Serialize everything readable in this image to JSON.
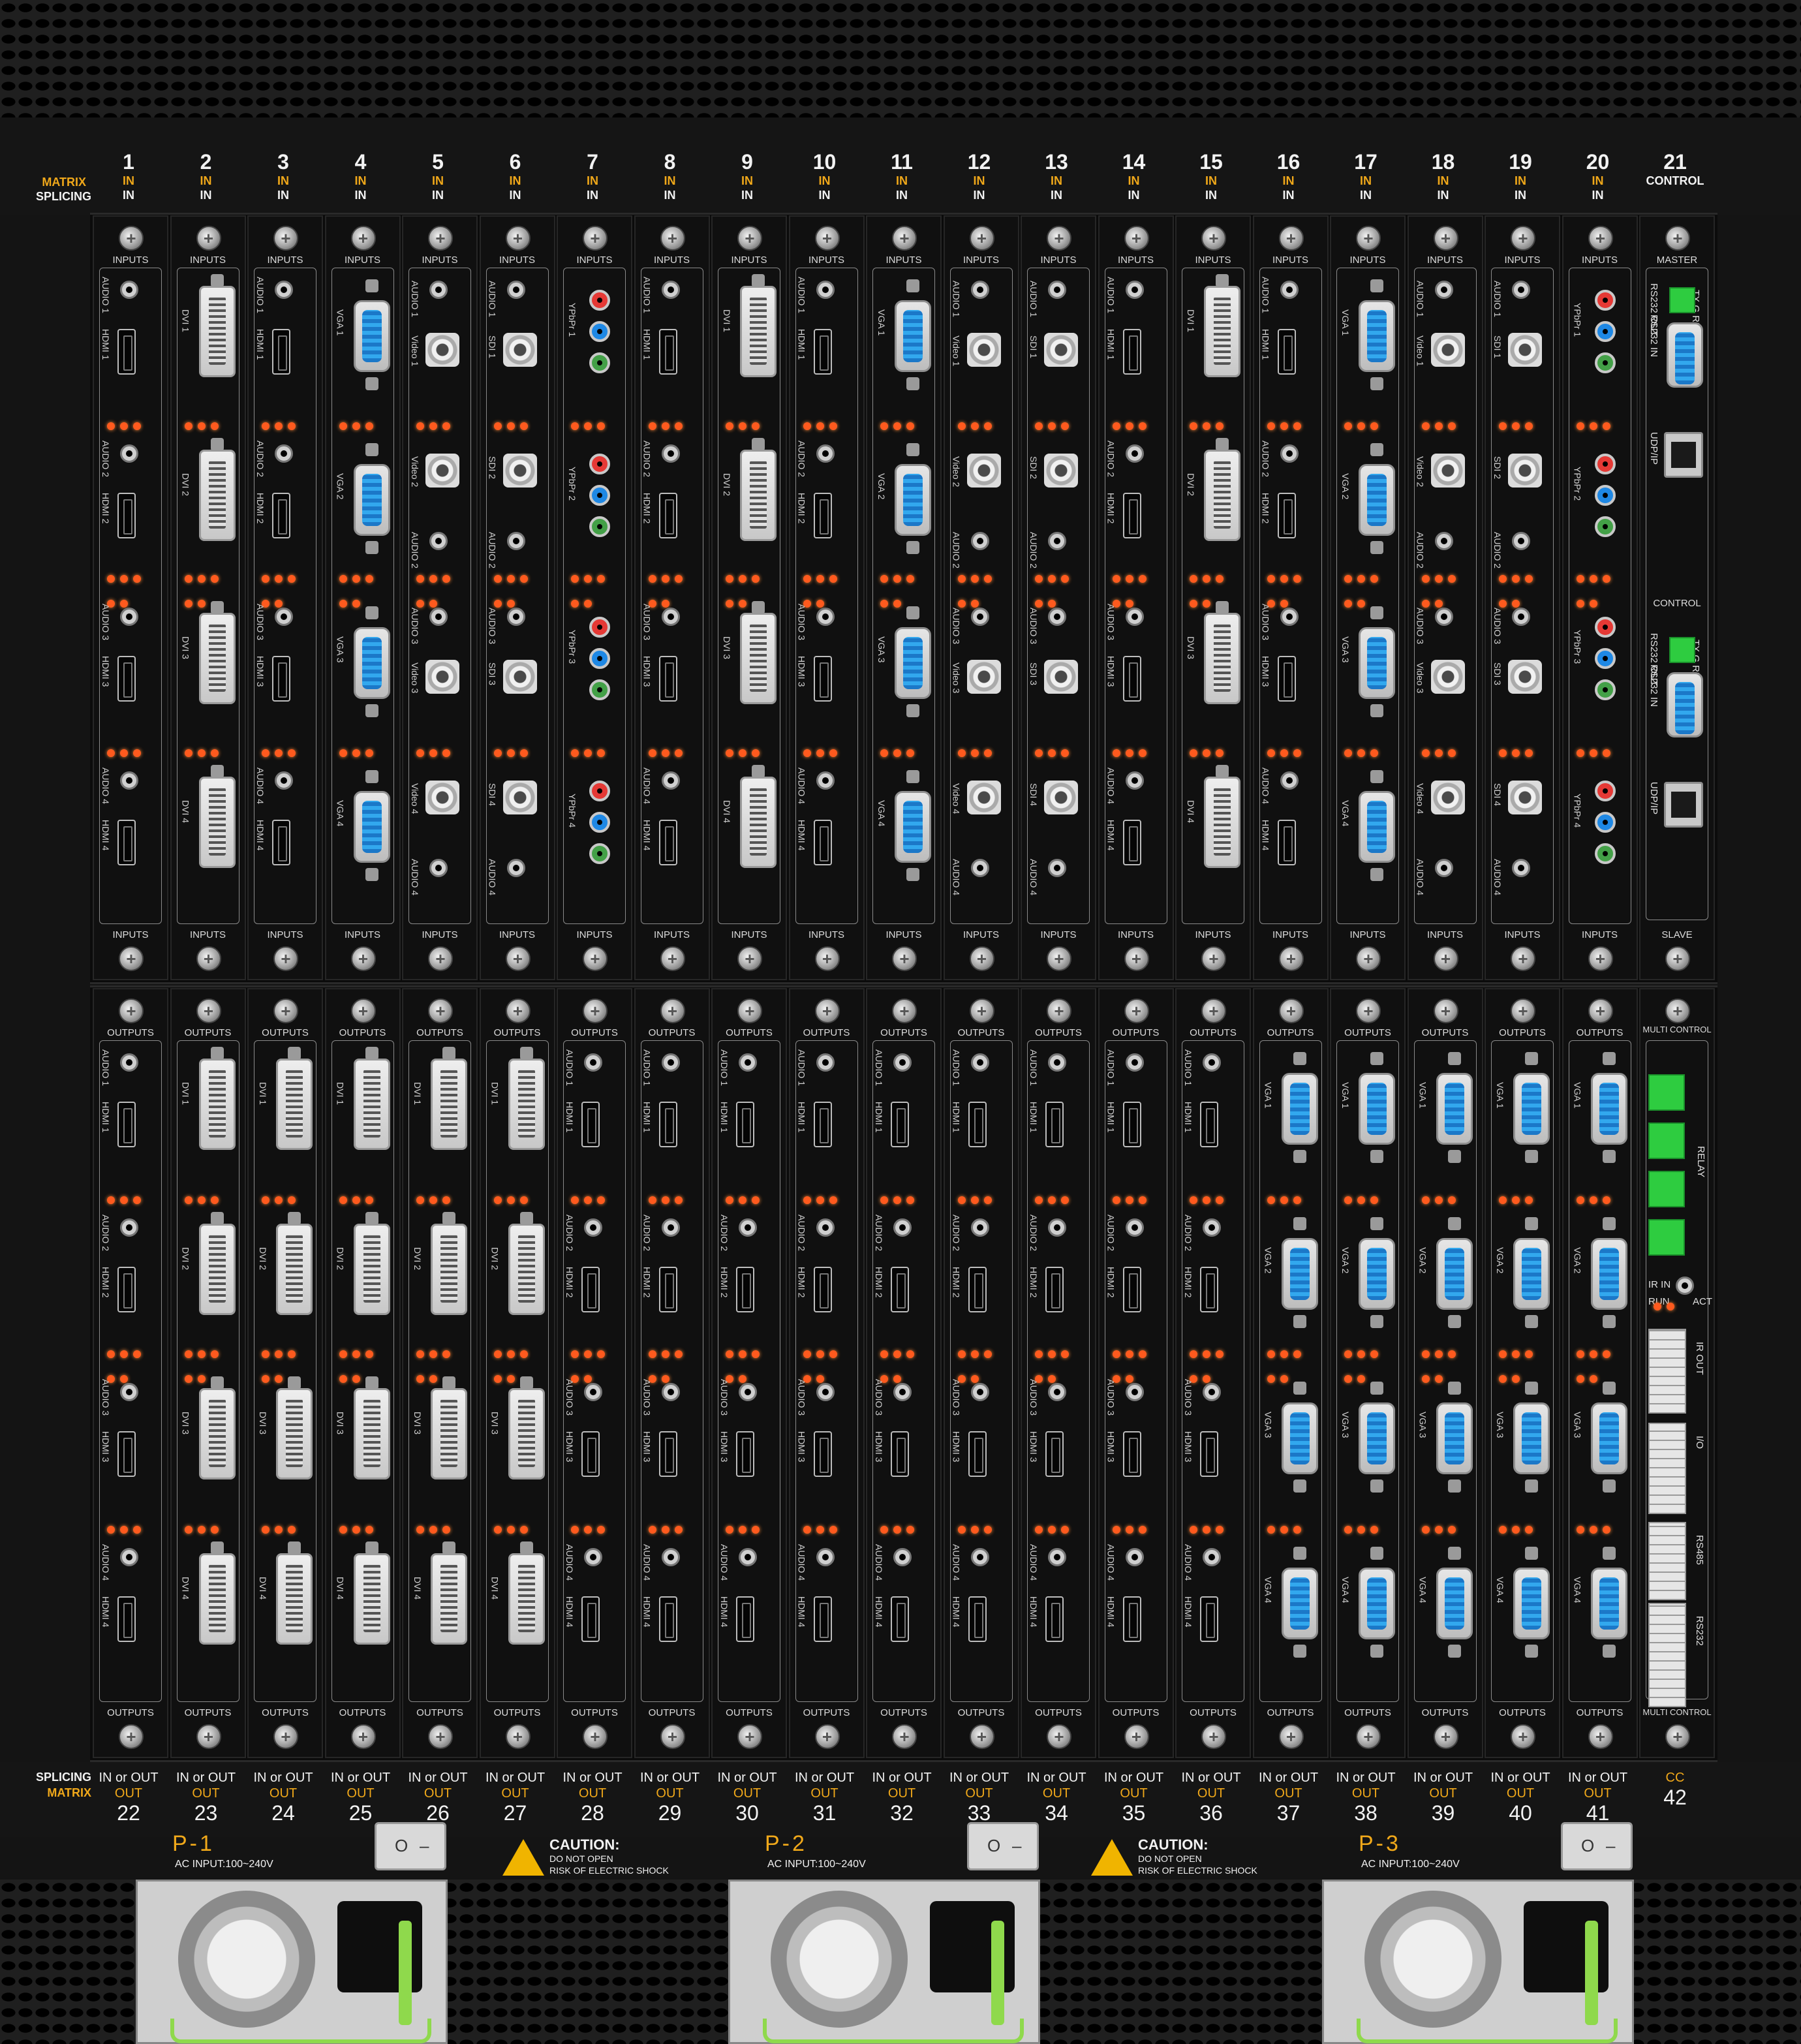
{
  "top_row": {
    "side_labels": {
      "matrix": "MATRIX",
      "splicing": "SPLICING"
    },
    "columns": [
      {
        "num": "1",
        "l1": "IN",
        "l2": "IN"
      },
      {
        "num": "2",
        "l1": "IN",
        "l2": "IN"
      },
      {
        "num": "3",
        "l1": "IN",
        "l2": "IN"
      },
      {
        "num": "4",
        "l1": "IN",
        "l2": "IN"
      },
      {
        "num": "5",
        "l1": "IN",
        "l2": "IN"
      },
      {
        "num": "6",
        "l1": "IN",
        "l2": "IN"
      },
      {
        "num": "7",
        "l1": "IN",
        "l2": "IN"
      },
      {
        "num": "8",
        "l1": "IN",
        "l2": "IN"
      },
      {
        "num": "9",
        "l1": "IN",
        "l2": "IN"
      },
      {
        "num": "10",
        "l1": "IN",
        "l2": "IN"
      },
      {
        "num": "11",
        "l1": "IN",
        "l2": "IN"
      },
      {
        "num": "12",
        "l1": "IN",
        "l2": "IN"
      },
      {
        "num": "13",
        "l1": "IN",
        "l2": "IN"
      },
      {
        "num": "14",
        "l1": "IN",
        "l2": "IN"
      },
      {
        "num": "15",
        "l1": "IN",
        "l2": "IN"
      },
      {
        "num": "16",
        "l1": "IN",
        "l2": "IN"
      },
      {
        "num": "17",
        "l1": "IN",
        "l2": "IN"
      },
      {
        "num": "18",
        "l1": "IN",
        "l2": "IN"
      },
      {
        "num": "19",
        "l1": "IN",
        "l2": "IN"
      },
      {
        "num": "20",
        "l1": "IN",
        "l2": "IN"
      },
      {
        "num": "21",
        "l1": "",
        "l2": "CONTROL"
      }
    ]
  },
  "input_cards": [
    {
      "title": "INPUTS",
      "type": "hdmi",
      "labels": [
        "AUDIO 1",
        "HDMI 1",
        "AUDIO 2",
        "HDMI 2",
        "AUDIO 3",
        "HDMI 3",
        "AUDIO 4",
        "HDMI 4"
      ]
    },
    {
      "title": "INPUTS",
      "type": "dvi",
      "labels": [
        "DVI 1",
        "DVI 2",
        "DVI 3",
        "DVI 4"
      ]
    },
    {
      "title": "INPUTS",
      "type": "hdmi",
      "labels": [
        "AUDIO 1",
        "HDMI 1",
        "AUDIO 2",
        "HDMI 2",
        "AUDIO 3",
        "HDMI 3",
        "AUDIO 4",
        "HDMI 4"
      ]
    },
    {
      "title": "INPUTS",
      "type": "vga",
      "labels": [
        "VGA 1",
        "VGA 2",
        "VGA 3",
        "VGA 4"
      ]
    },
    {
      "title": "INPUTS",
      "type": "bnc",
      "labels": [
        "AUDIO 1",
        "Video 1",
        "Video 2",
        "AUDIO 2",
        "AUDIO 3",
        "Video 3",
        "Video 4",
        "AUDIO 4"
      ]
    },
    {
      "title": "INPUTS",
      "type": "bnc",
      "labels": [
        "AUDIO 1",
        "SDI 1",
        "SDI 2",
        "AUDIO 2",
        "AUDIO 3",
        "SDI 3",
        "SDI 4",
        "AUDIO 4"
      ]
    },
    {
      "title": "INPUTS",
      "type": "ypbpr",
      "labels": [
        "YPbPr 1",
        "YPbPr 2",
        "YPbPr 3",
        "YPbPr 4"
      ]
    },
    {
      "title": "INPUTS",
      "type": "hdmi",
      "labels": [
        "AUDIO 1",
        "HDMI 1",
        "AUDIO 2",
        "HDMI 2",
        "AUDIO 3",
        "HDMI 3",
        "AUDIO 4",
        "HDMI 4"
      ]
    },
    {
      "title": "INPUTS",
      "type": "dvi",
      "labels": [
        "DVI 1",
        "DVI 2",
        "DVI 3",
        "DVI 4"
      ]
    },
    {
      "title": "INPUTS",
      "type": "hdmi",
      "labels": [
        "AUDIO 1",
        "HDMI 1",
        "AUDIO 2",
        "HDMI 2",
        "AUDIO 3",
        "HDMI 3",
        "AUDIO 4",
        "HDMI 4"
      ]
    },
    {
      "title": "INPUTS",
      "type": "vga",
      "labels": [
        "VGA 1",
        "VGA 2",
        "VGA 3",
        "VGA 4"
      ]
    },
    {
      "title": "INPUTS",
      "type": "bnc",
      "labels": [
        "AUDIO 1",
        "Video 1",
        "Video 2",
        "AUDIO 2",
        "AUDIO 3",
        "Video 3",
        "Video 4",
        "AUDIO 4"
      ]
    },
    {
      "title": "INPUTS",
      "type": "bnc",
      "labels": [
        "AUDIO 1",
        "SDI 1",
        "SDI 2",
        "AUDIO 2",
        "AUDIO 3",
        "SDI 3",
        "SDI 4",
        "AUDIO 4"
      ]
    },
    {
      "title": "INPUTS",
      "type": "hdmi",
      "labels": [
        "AUDIO 1",
        "HDMI 1",
        "AUDIO 2",
        "HDMI 2",
        "AUDIO 3",
        "HDMI 3",
        "AUDIO 4",
        "HDMI 4"
      ]
    },
    {
      "title": "INPUTS",
      "type": "dvi",
      "labels": [
        "DVI 1",
        "DVI 2",
        "DVI 3",
        "DVI 4"
      ]
    },
    {
      "title": "INPUTS",
      "type": "hdmi",
      "labels": [
        "AUDIO 1",
        "HDMI 1",
        "AUDIO 2",
        "HDMI 2",
        "AUDIO 3",
        "HDMI 3",
        "AUDIO 4",
        "HDMI 4"
      ]
    },
    {
      "title": "INPUTS",
      "type": "vga",
      "labels": [
        "VGA 1",
        "VGA 2",
        "VGA 3",
        "VGA 4"
      ]
    },
    {
      "title": "INPUTS",
      "type": "bnc",
      "labels": [
        "AUDIO 1",
        "Video 1",
        "Video 2",
        "AUDIO 2",
        "AUDIO 3",
        "Video 3",
        "Video 4",
        "AUDIO 4"
      ]
    },
    {
      "title": "INPUTS",
      "type": "bnc",
      "labels": [
        "AUDIO 1",
        "SDI 1",
        "SDI 2",
        "AUDIO 2",
        "AUDIO 3",
        "SDI 3",
        "SDI 4",
        "AUDIO 4"
      ]
    },
    {
      "title": "INPUTS",
      "type": "ypbpr",
      "labels": [
        "YPbPr 1",
        "YPbPr 2",
        "YPbPr 3",
        "YPbPr 4"
      ]
    }
  ],
  "control_card_top": {
    "title_top": "MASTER",
    "title_bottom": "SLAVE",
    "mid": "CONTROL",
    "rs232_out": "RS232 OUT",
    "rs232_in": "RS232 IN",
    "udp": "UDP/IP",
    "txgrx": "TX G RX"
  },
  "output_cards": [
    {
      "title": "OUTPUTS",
      "type": "hdmi",
      "labels": [
        "AUDIO 1",
        "HDMI 1",
        "AUDIO 2",
        "HDMI 2",
        "AUDIO 3",
        "HDMI 3",
        "AUDIO 4",
        "HDMI 4"
      ]
    },
    {
      "title": "OUTPUTS",
      "type": "dvi",
      "labels": [
        "DVI 1",
        "DVI 2",
        "DVI 3",
        "DVI 4"
      ]
    },
    {
      "title": "OUTPUTS",
      "type": "dvi",
      "labels": [
        "DVI 1",
        "DVI 2",
        "DVI 3",
        "DVI 4"
      ]
    },
    {
      "title": "OUTPUTS",
      "type": "dvi",
      "labels": [
        "DVI 1",
        "DVI 2",
        "DVI 3",
        "DVI 4"
      ]
    },
    {
      "title": "OUTPUTS",
      "type": "dvi",
      "labels": [
        "DVI 1",
        "DVI 2",
        "DVI 3",
        "DVI 4"
      ]
    },
    {
      "title": "OUTPUTS",
      "type": "dvi",
      "labels": [
        "DVI 1",
        "DVI 2",
        "DVI 3",
        "DVI 4"
      ]
    },
    {
      "title": "OUTPUTS",
      "type": "hdmi",
      "labels": [
        "AUDIO 1",
        "HDMI 1",
        "AUDIO 2",
        "HDMI 2",
        "AUDIO 3",
        "HDMI 3",
        "AUDIO 4",
        "HDMI 4"
      ]
    },
    {
      "title": "OUTPUTS",
      "type": "hdmi",
      "labels": [
        "AUDIO 1",
        "HDMI 1",
        "AUDIO 2",
        "HDMI 2",
        "AUDIO 3",
        "HDMI 3",
        "AUDIO 4",
        "HDMI 4"
      ]
    },
    {
      "title": "OUTPUTS",
      "type": "hdmi",
      "labels": [
        "AUDIO 1",
        "HDMI 1",
        "AUDIO 2",
        "HDMI 2",
        "AUDIO 3",
        "HDMI 3",
        "AUDIO 4",
        "HDMI 4"
      ]
    },
    {
      "title": "OUTPUTS",
      "type": "hdmi",
      "labels": [
        "AUDIO 1",
        "HDMI 1",
        "AUDIO 2",
        "HDMI 2",
        "AUDIO 3",
        "HDMI 3",
        "AUDIO 4",
        "HDMI 4"
      ]
    },
    {
      "title": "OUTPUTS",
      "type": "hdmi",
      "labels": [
        "AUDIO 1",
        "HDMI 1",
        "AUDIO 2",
        "HDMI 2",
        "AUDIO 3",
        "HDMI 3",
        "AUDIO 4",
        "HDMI 4"
      ]
    },
    {
      "title": "OUTPUTS",
      "type": "hdmi",
      "labels": [
        "AUDIO 1",
        "HDMI 1",
        "AUDIO 2",
        "HDMI 2",
        "AUDIO 3",
        "HDMI 3",
        "AUDIO 4",
        "HDMI 4"
      ]
    },
    {
      "title": "OUTPUTS",
      "type": "hdmi",
      "labels": [
        "AUDIO 1",
        "HDMI 1",
        "AUDIO 2",
        "HDMI 2",
        "AUDIO 3",
        "HDMI 3",
        "AUDIO 4",
        "HDMI 4"
      ]
    },
    {
      "title": "OUTPUTS",
      "type": "hdmi",
      "labels": [
        "AUDIO 1",
        "HDMI 1",
        "AUDIO 2",
        "HDMI 2",
        "AUDIO 3",
        "HDMI 3",
        "AUDIO 4",
        "HDMI 4"
      ]
    },
    {
      "title": "OUTPUTS",
      "type": "hdmi",
      "labels": [
        "AUDIO 1",
        "HDMI 1",
        "AUDIO 2",
        "HDMI 2",
        "AUDIO 3",
        "HDMI 3",
        "AUDIO 4",
        "HDMI 4"
      ]
    },
    {
      "title": "OUTPUTS",
      "type": "vga",
      "labels": [
        "VGA 1",
        "VGA 2",
        "VGA 3",
        "VGA 4"
      ]
    },
    {
      "title": "OUTPUTS",
      "type": "vga",
      "labels": [
        "VGA 1",
        "VGA 2",
        "VGA 3",
        "VGA 4"
      ]
    },
    {
      "title": "OUTPUTS",
      "type": "vga",
      "labels": [
        "VGA 1",
        "VGA 2",
        "VGA 3",
        "VGA 4"
      ]
    },
    {
      "title": "OUTPUTS",
      "type": "vga",
      "labels": [
        "VGA 1",
        "VGA 2",
        "VGA 3",
        "VGA 4"
      ]
    },
    {
      "title": "OUTPUTS",
      "type": "vga",
      "labels": [
        "VGA 1",
        "VGA 2",
        "VGA 3",
        "VGA 4"
      ]
    }
  ],
  "control_card_bottom": {
    "title_top": "MULTI CONTROL",
    "title_bottom": "MULTI CONTROL",
    "relay": "RELAY",
    "ir_in": "IR IN",
    "run": "RUN",
    "act": "ACT",
    "ir_out": "IR OUT",
    "io": "I/O",
    "rs485": "RS485",
    "rs232": "RS232"
  },
  "bottom_row": {
    "side_labels": {
      "splicing": "SPLICING",
      "matrix": "MATRIX"
    },
    "columns": [
      {
        "l1": "IN or OUT",
        "l2": "OUT",
        "num": "22"
      },
      {
        "l1": "IN or OUT",
        "l2": "OUT",
        "num": "23"
      },
      {
        "l1": "IN or OUT",
        "l2": "OUT",
        "num": "24"
      },
      {
        "l1": "IN or OUT",
        "l2": "OUT",
        "num": "25"
      },
      {
        "l1": "IN or OUT",
        "l2": "OUT",
        "num": "26"
      },
      {
        "l1": "IN or OUT",
        "l2": "OUT",
        "num": "27"
      },
      {
        "l1": "IN or OUT",
        "l2": "OUT",
        "num": "28"
      },
      {
        "l1": "IN or OUT",
        "l2": "OUT",
        "num": "29"
      },
      {
        "l1": "IN or OUT",
        "l2": "OUT",
        "num": "30"
      },
      {
        "l1": "IN or OUT",
        "l2": "OUT",
        "num": "31"
      },
      {
        "l1": "IN or OUT",
        "l2": "OUT",
        "num": "32"
      },
      {
        "l1": "IN or OUT",
        "l2": "OUT",
        "num": "33"
      },
      {
        "l1": "IN or OUT",
        "l2": "OUT",
        "num": "34"
      },
      {
        "l1": "IN or OUT",
        "l2": "OUT",
        "num": "35"
      },
      {
        "l1": "IN or OUT",
        "l2": "OUT",
        "num": "36"
      },
      {
        "l1": "IN or OUT",
        "l2": "OUT",
        "num": "37"
      },
      {
        "l1": "IN or OUT",
        "l2": "OUT",
        "num": "38"
      },
      {
        "l1": "IN or OUT",
        "l2": "OUT",
        "num": "39"
      },
      {
        "l1": "IN or OUT",
        "l2": "OUT",
        "num": "40"
      },
      {
        "l1": "IN or OUT",
        "l2": "OUT",
        "num": "41"
      },
      {
        "l1": "",
        "l2": "CC",
        "num": "42"
      }
    ]
  },
  "power_supplies": [
    {
      "name": "P-1",
      "ac": "AC INPUT:100~240V",
      "switch_on": "O",
      "switch_off": "–"
    },
    {
      "name": "P-2",
      "ac": "AC INPUT:100~240V",
      "switch_on": "O",
      "switch_off": "–"
    },
    {
      "name": "P-3",
      "ac": "AC INPUT:100~240V",
      "switch_on": "O",
      "switch_off": "–"
    }
  ],
  "caution": {
    "title": "CAUTION:",
    "line1": "DO NOT OPEN",
    "line2": "RISK OF ELECTRIC SHOCK"
  },
  "colors": {
    "accent": "#f0a81a",
    "led": "#ff5a1e",
    "vga": "#32a8ee",
    "terminal": "#2ecc40",
    "handle": "#8fd94c",
    "ypbpr": [
      "#e53935",
      "#1e88e5",
      "#43a047"
    ]
  }
}
